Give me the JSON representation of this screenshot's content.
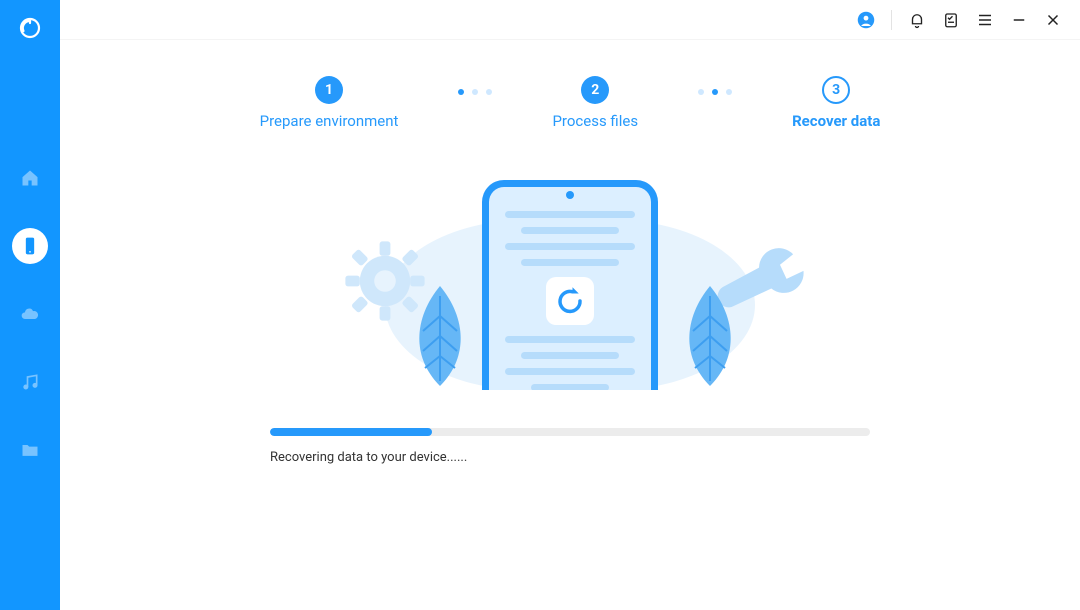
{
  "colors": {
    "primary": "#1296ff",
    "accent": "#2699fb"
  },
  "sidebar": {
    "items": [
      {
        "name": "home",
        "active": false
      },
      {
        "name": "device",
        "active": true
      },
      {
        "name": "cloud",
        "active": false
      },
      {
        "name": "music",
        "active": false
      },
      {
        "name": "folder",
        "active": false
      }
    ]
  },
  "titlebar": {
    "items": [
      "account",
      "notifications",
      "tasks",
      "menu",
      "minimize",
      "close"
    ]
  },
  "steps": [
    {
      "num": "1",
      "label": "Prepare environment",
      "filled": true,
      "active": false
    },
    {
      "num": "2",
      "label": "Process files",
      "filled": true,
      "active": false
    },
    {
      "num": "3",
      "label": "Recover data",
      "filled": false,
      "active": true
    }
  ],
  "progress": {
    "percent": 27,
    "label": "Recovering data to your device......"
  }
}
